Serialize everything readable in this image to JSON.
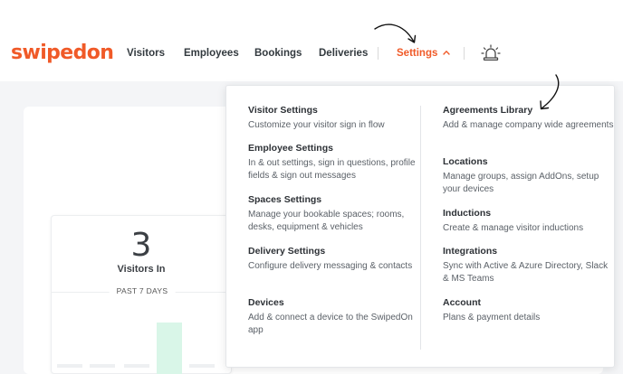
{
  "brand": {
    "logo_text": "swipedon",
    "accent_color": "#f05a28"
  },
  "nav": {
    "items": [
      {
        "label": "Visitors"
      },
      {
        "label": "Employees"
      },
      {
        "label": "Bookings"
      },
      {
        "label": "Deliveries"
      }
    ],
    "settings_label": "Settings",
    "settings_icon": "chevron-up-icon",
    "alarm_icon": "evacuation-alarm-icon"
  },
  "dashboard": {
    "visitors_in_count": "3",
    "visitors_in_label": "Visitors In",
    "period_label": "PAST 7 DAYS"
  },
  "settings_menu": {
    "left": [
      {
        "title": "Visitor Settings",
        "desc": "Customize your visitor sign in flow"
      },
      {
        "title": "Employee Settings",
        "desc": "In & out settings, sign in questions, profile fields & sign out messages"
      },
      {
        "title": "Spaces Settings",
        "desc": "Manage your bookable spaces; rooms, desks, equipment & vehicles"
      },
      {
        "title": "Delivery Settings",
        "desc": "Configure delivery messaging & contacts"
      },
      {
        "title": "Devices",
        "desc": "Add & connect a device to the SwipedOn app"
      }
    ],
    "right": [
      {
        "title": "Agreements Library",
        "desc": "Add & manage company wide agreements"
      },
      {
        "title": "Locations",
        "desc": "Manage groups, assign AddOns, setup your devices"
      },
      {
        "title": "Inductions",
        "desc": "Create & manage visitor inductions"
      },
      {
        "title": "Integrations",
        "desc": "Sync with Active & Azure Directory, Slack & MS Teams"
      },
      {
        "title": "Account",
        "desc": "Plans & payment details"
      }
    ]
  }
}
